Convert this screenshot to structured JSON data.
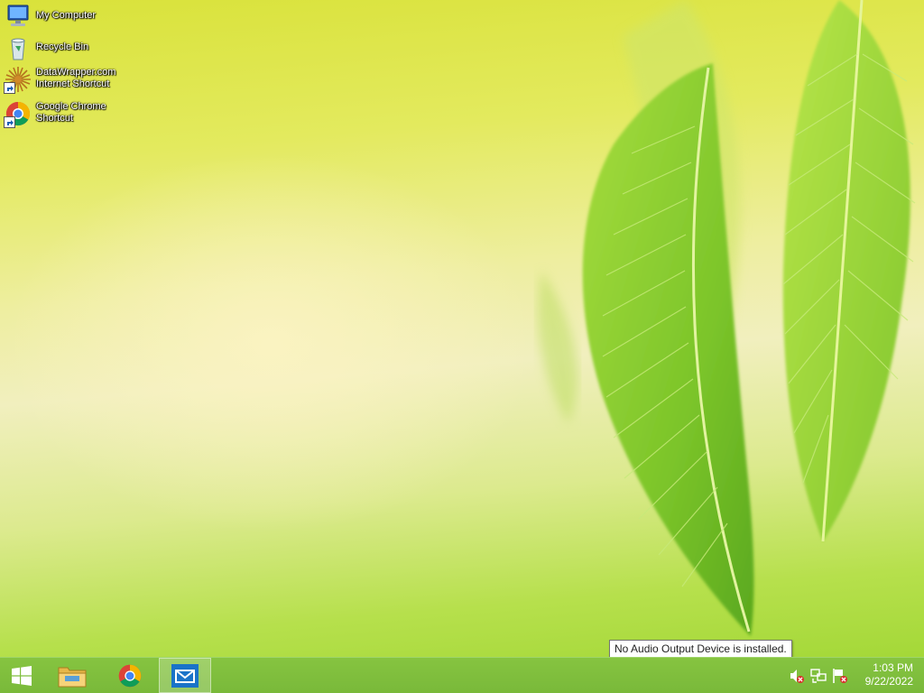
{
  "desktop": {
    "icons": [
      {
        "label": "My Computer",
        "icon": "computer-icon"
      },
      {
        "label": "Recycle Bin",
        "icon": "recycle-bin-icon"
      },
      {
        "label": "DataWrapper.com Internet Shortcut",
        "icon": "sunburst-logo-icon",
        "shortcut": true
      },
      {
        "label": "Google Chrome Shortcut",
        "icon": "chrome-icon",
        "shortcut": true
      }
    ]
  },
  "tooltip": {
    "text": "No Audio Output Device is installed."
  },
  "taskbar": {
    "start_icon": "windows-logo-icon",
    "pinned": [
      {
        "name": "File Explorer",
        "icon": "folder-icon"
      },
      {
        "name": "Google Chrome",
        "icon": "chrome-icon"
      },
      {
        "name": "Mail",
        "icon": "mail-icon",
        "active": true
      }
    ],
    "tray": {
      "icons": [
        "speaker-muted-icon",
        "network-icon",
        "action-center-flag-icon"
      ],
      "time": "1:03 PM",
      "date": "9/22/2022"
    }
  },
  "colors": {
    "taskbar": "#7dbd3c",
    "accent": "#1a73c8"
  }
}
